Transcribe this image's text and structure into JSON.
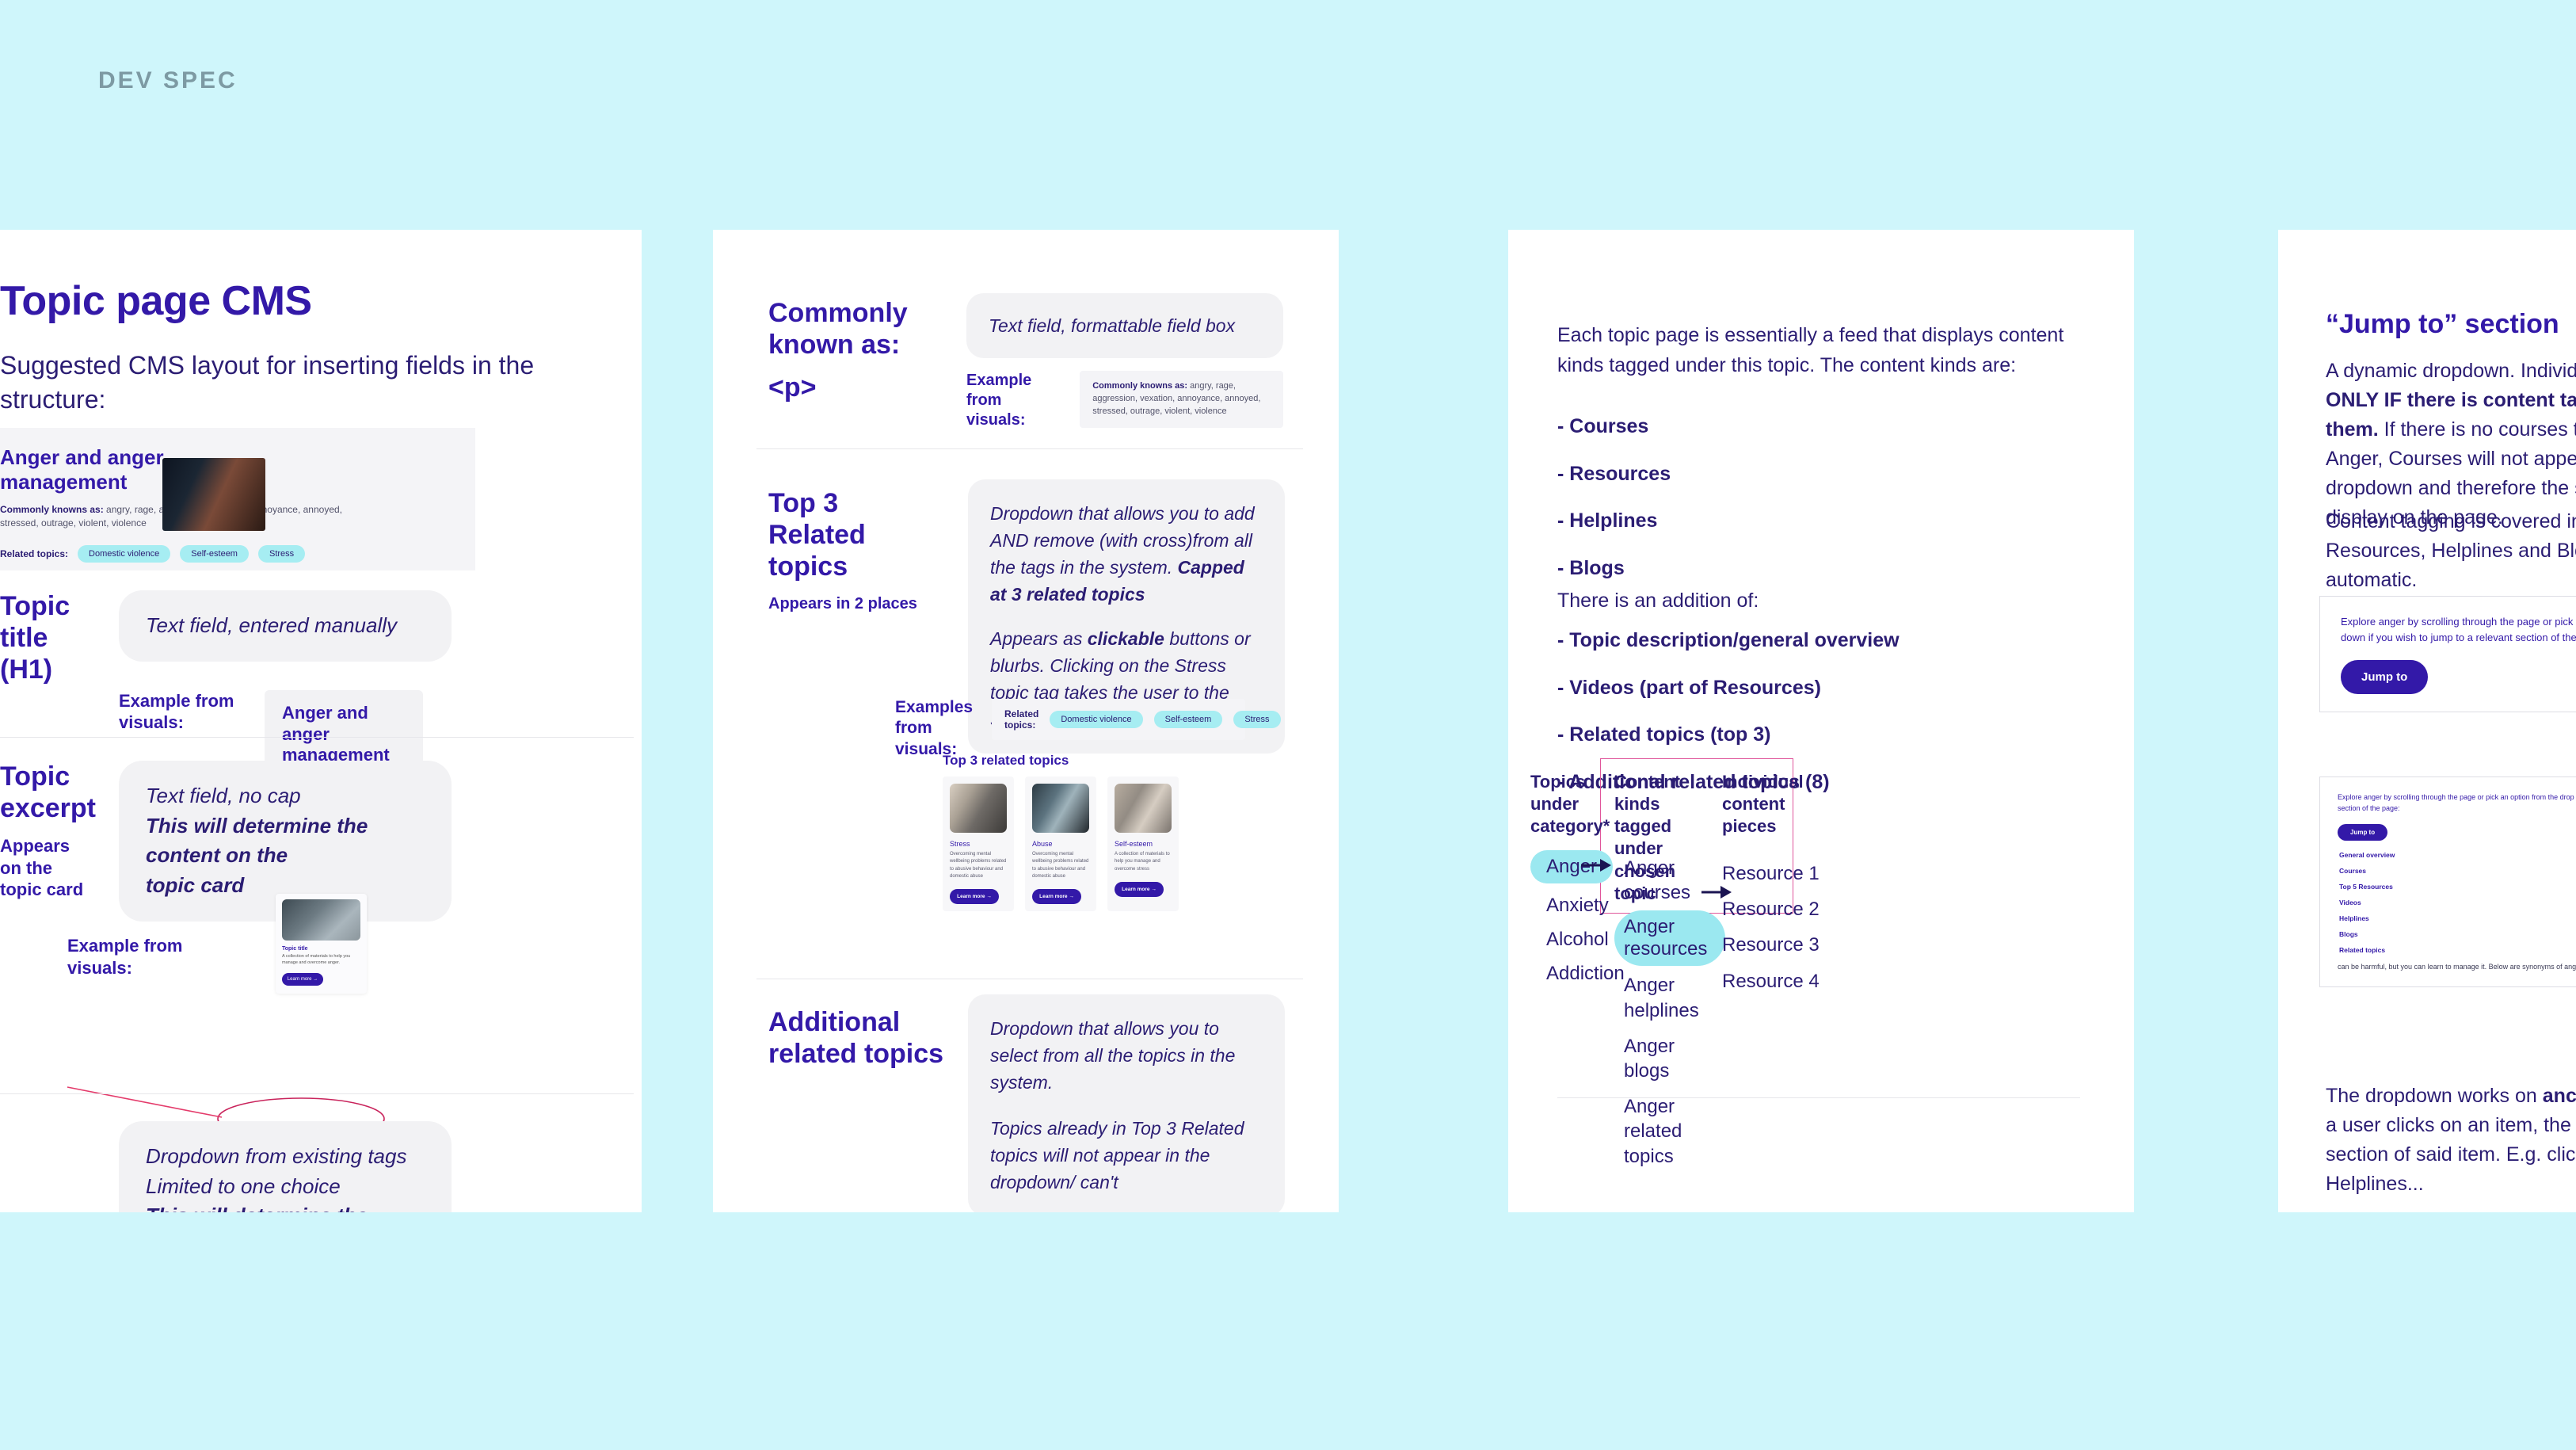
{
  "header": {
    "label": "DEV SPEC"
  },
  "card1": {
    "title": "Topic page CMS",
    "subtitle": "Suggested CMS layout for inserting fields in the structure:",
    "visual_preview": {
      "title": "Anger and anger management",
      "known_label": "Commonly knowns as:",
      "known_text": "angry, rage, aggression, vexation, annoyance, annoyed, stressed, outrage, violent, violence",
      "related_label": "Related topics:",
      "related_tags": [
        "Domestic violence",
        "Self-esteem",
        "Stress"
      ]
    },
    "rows": [
      {
        "label": "Topic title (H1)",
        "bubble": "Text field, entered manually",
        "example_label": "Example from visuals:",
        "example_value": "Anger and anger management"
      },
      {
        "label": "Topic excerpt",
        "note": "Appears on the topic card",
        "bubble_line1": "Text field, no cap",
        "bubble_line2": "This will determine the content on the",
        "bubble_line3": "topic card",
        "example_label": "Example from visuals:",
        "mini_card": {
          "title": "Topic title",
          "desc": "A collection of materials to help you manage and overcome anger.",
          "button": "Learn more →"
        }
      },
      {
        "bubble_line1": "Dropdown from existing tags",
        "bubble_line2": "Limited to one choice",
        "bubble_line3": "This will determine the content feed below"
      }
    ]
  },
  "card2": {
    "sections": [
      {
        "label": "Commonly known as:",
        "label2": "<p>",
        "bubble": "Text field, formattable field box",
        "example_label": "Example from visuals:",
        "example_known_label": "Commonly knowns as:",
        "example_known_text": "angry, rage, aggression, vexation, annoyance, annoyed, stressed, outrage, violent, violence"
      },
      {
        "label": "Top 3 Related topics",
        "note": "Appears in 2 places",
        "bubble_p1_a": "Dropdown that allows you to add AND remove (with cross)from all the tags in the system. ",
        "bubble_p1_b": "Capped at 3 related topics",
        "bubble_p2_a": "Appears as ",
        "bubble_p2_b": "clickable",
        "bubble_p2_c": " buttons or blurbs. Clicking on the Stress topic tag takes the user to the Stress topic page.",
        "examples_label": "Examples from visuals:",
        "related_label": "Related topics:",
        "related_tags": [
          "Domestic violence",
          "Self-esteem",
          "Stress"
        ],
        "t3_head": "Top 3 related topics",
        "topic_cards": [
          {
            "title": "Stress",
            "desc": "Overcoming mental wellbeing problems related to abusive behaviour and domestic abuse",
            "button": "Learn more →"
          },
          {
            "title": "Abuse",
            "desc": "Overcoming mental wellbeing problems related to abusive behaviour and domestic abuse",
            "button": "Learn more →"
          },
          {
            "title": "Self-esteem",
            "desc": "A collection of materials to help you manage and overcome stress",
            "button": "Learn more →"
          }
        ]
      },
      {
        "label": "Additional related topics",
        "bubble_p1": "Dropdown that allows you to select from all the topics in the system.",
        "bubble_p2": "Topics already in Top 3 Related topics will not appear in the dropdown/ can't"
      }
    ]
  },
  "card3": {
    "intro": "Each topic page is essentially a feed that displays content kinds tagged under this topic. The content kinds are:",
    "kinds": [
      "- Courses",
      "- Resources",
      "- Helplines",
      "- Blogs"
    ],
    "addition_label": "There is an addition of:",
    "additions": [
      "- Topic description/general overview",
      "- Videos (part of Resources)",
      "- Related topics (top 3)",
      "- Additional related topics (8)"
    ],
    "diagram": {
      "col1_head": "Topics under category*",
      "col2_head": "Content kinds tagged under chosen topic",
      "col3_head": "Individual content pieces",
      "col1_items": [
        "Anger",
        "Anxiety",
        "Alcohol",
        "Addiction"
      ],
      "col1_highlight": "Anger",
      "col2_items": [
        "Anger courses",
        "Anger resources",
        "Anger helplines",
        "Anger blogs",
        "Anger related topics"
      ],
      "col2_highlight": "Anger resources",
      "col3_items": [
        "Resource 1",
        "Resource 2",
        "Resource 3",
        "Resource 4"
      ]
    }
  },
  "card4": {
    "title": "“Jump to” section",
    "p1_a": "A dynamic dropdown. Individual items appear ",
    "p1_b": "ONLY IF there is content tagged under them.",
    "p1_c": " If there is no courses tagged under Anger, Courses will not appear in the dropdown and therefore the section will not display on the page.",
    "p2": "Content tagging is covered in the Courses, Resources, Helplines and Blogs links. It is automatic.",
    "mock1": {
      "text": "Explore anger by scrolling through the page or pick an option from the drop down if you wish to jump to a relevant section of the page:",
      "button": "Jump to"
    },
    "mock2": {
      "text": "Explore anger by scrolling through the page or pick an option from the drop down if you wish to jump to a relevant section of the page:",
      "button": "Jump to",
      "options": [
        "General overview",
        "Courses",
        "Top 5 Resources",
        "Videos",
        "Helplines",
        "Blogs",
        "Related topics"
      ],
      "tail": "can be harmful, but you can learn to manage it. Below are synonyms of anger and anger management in..."
    },
    "p3_a": "The dropdown works on ",
    "p3_b": "anchor links",
    "p3_c": ". When a user clicks on an item, the page scrolls to the section of said item. E.g. clicking on Helplines..."
  },
  "colors": {
    "page_bg": "#CFF6FB",
    "brand_purple": "#3319A8",
    "ink": "#2B1D73",
    "pill_cyan": "#A6EDF2",
    "pink_border": "#E0569B"
  }
}
